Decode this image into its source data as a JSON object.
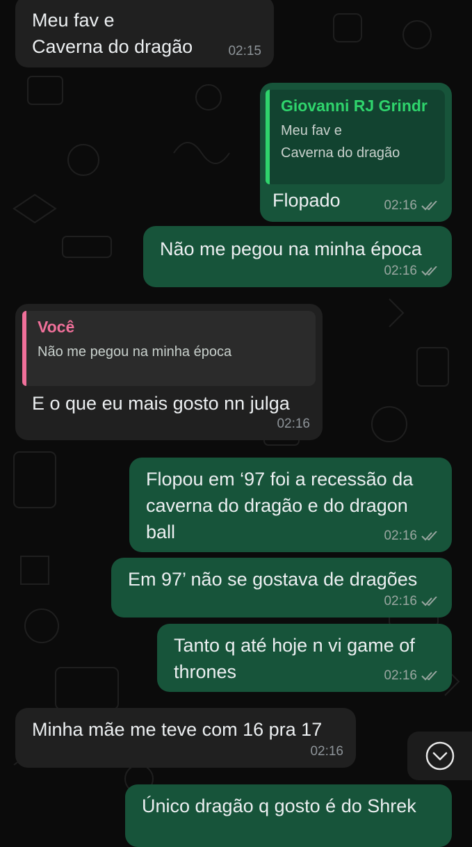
{
  "colors": {
    "incoming_bubble": "#202020",
    "outgoing_bubble": "#17543a",
    "quote_author_contact": "#2fd46c",
    "quote_author_self": "#f0709a",
    "timestamp": "#9aa7a1"
  },
  "messages": [
    {
      "direction": "in",
      "text": "Meu fav e\nCaverna do dragão",
      "time": "02:15"
    },
    {
      "direction": "out",
      "quote": {
        "author": "Giovanni RJ Grindr",
        "text": "Meu fav e\nCaverna do dragão"
      },
      "text": "Flopado",
      "time": "02:16",
      "status": "double-check-icon"
    },
    {
      "direction": "out",
      "text": "Não me pegou na minha época",
      "time": "02:16",
      "status": "double-check-icon"
    },
    {
      "direction": "in",
      "quote": {
        "author": "Você",
        "text": "Não me pegou na minha época"
      },
      "text": "E o que eu mais gosto nn julga",
      "time": "02:16"
    },
    {
      "direction": "out",
      "text": "Flopou em ‘97 foi a recessão da\ncaverna do dragão e do dragon\nball",
      "time": "02:16",
      "status": "double-check-icon"
    },
    {
      "direction": "out",
      "text": "Em 97’ não se gostava de dragões",
      "time": "02:16",
      "status": "double-check-icon"
    },
    {
      "direction": "out",
      "text": "Tanto q até hoje n vi game of\nthrones",
      "time": "02:16",
      "status": "double-check-icon"
    },
    {
      "direction": "in",
      "text": "Minha mãe me teve com 16 pra 17",
      "time": "02:16"
    },
    {
      "direction": "out",
      "text": "Único dragão q gosto é do Shrek",
      "time": ""
    }
  ],
  "scroll_button": {
    "icon": "chevron-down-circle-icon"
  }
}
